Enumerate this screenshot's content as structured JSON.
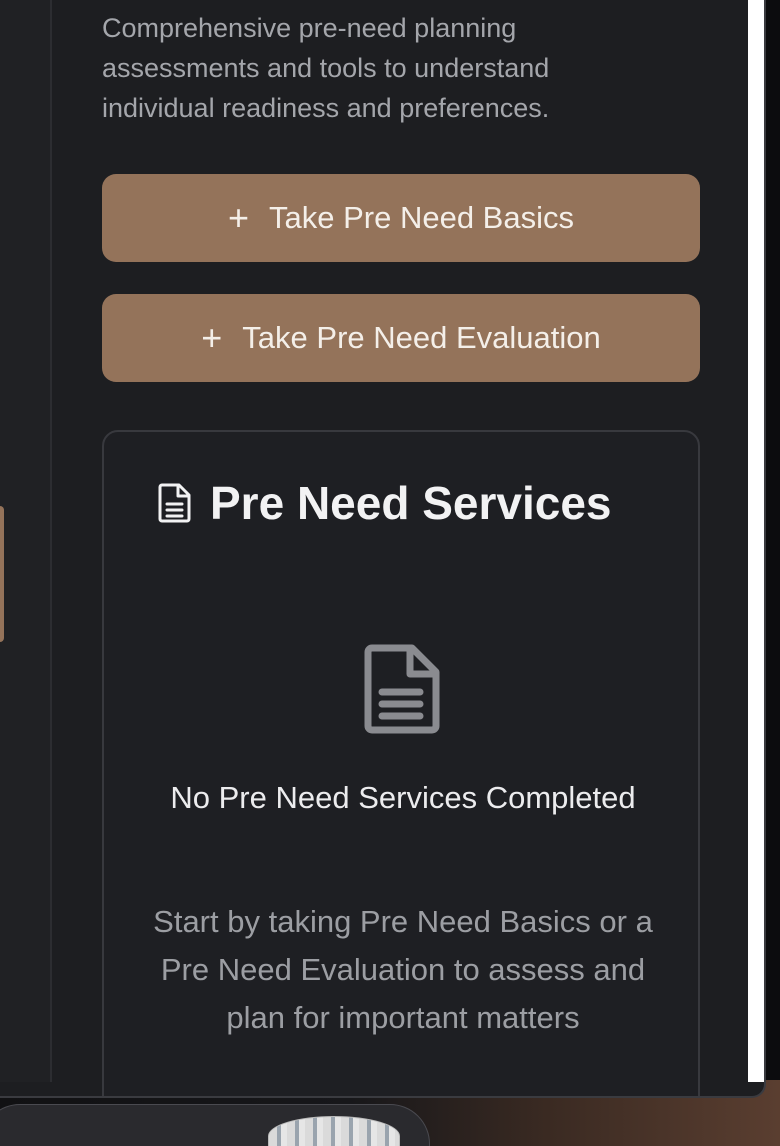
{
  "intro": {
    "description": "Comprehensive pre-need planning assessments and tools to understand individual readiness and preferences."
  },
  "actions": {
    "basics_label": "Take Pre Need Basics",
    "evaluation_label": "Take Pre Need Evaluation",
    "plus_glyph": "+"
  },
  "services_card": {
    "title": "Pre Need Services",
    "title_icon": "document-icon",
    "empty_icon": "document-icon",
    "empty_title": "No Pre Need Services Completed",
    "empty_description": "Start by taking Pre Need Basics or a Pre Need Evaluation to assess and plan for important matters"
  },
  "colors": {
    "accent": "#94735a",
    "background": "#1d1e21",
    "text_primary": "#f2f2f3",
    "text_muted": "#a4a6ab"
  }
}
